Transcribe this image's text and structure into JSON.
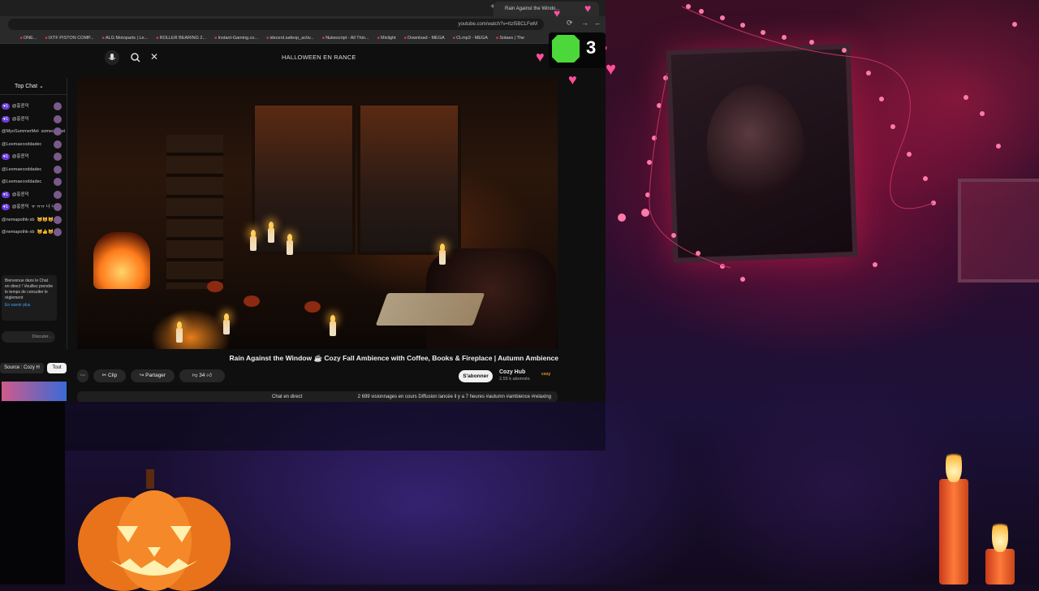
{
  "browser": {
    "tab_title": "Rain Against the Windo...",
    "address": "youtube.com/watch?v=ItzI5BCLFwM",
    "bookmarks": [
      "Solaes | The",
      "CLmp3 - MEGA",
      "Download - MEGA",
      "Mixlight",
      "Nukescript - All Thin...",
      "idecent.safeop_activ...",
      "Instant-Gaming.co...",
      "ROLLER BEARING 2...",
      "ALG Motoparts | Le...",
      "IXTF PISTON COMP...",
      "ONE..."
    ]
  },
  "youtube": {
    "search_query": "HALLOWEEN EN RANCE",
    "video_title": "Rain Against the Window ☕ Cozy Fall Ambience with Coffee, Books & Fireplace | Autumn Ambience",
    "channel_name": "Cozy Hub",
    "subscribers": "2,55 k abonnés",
    "channel_logo_text": "cozy",
    "subscribe_label": "S'abonner",
    "likes": "34",
    "share_label": "Partager",
    "clip_label": "Clip",
    "description": "2 699 visionnages en cours   Diffusion lancée il y a 7 heures   #autumn #ambience #relaxing",
    "live_chat_label": "Chat en direct"
  },
  "chat": {
    "header": "Top Chat",
    "messages": [
      {
        "user": "@홍콩덕",
        "text": "",
        "badge": "♥1"
      },
      {
        "user": "@홍콩덕",
        "text": "",
        "badge": "♥1"
      },
      {
        "user": "@MyoSummerMel",
        "text": "someone will give a Fake World",
        "badge": ""
      },
      {
        "user": "@Leemaecoddadec",
        "text": "",
        "badge": ""
      },
      {
        "user": "@홍콩덕",
        "text": "",
        "badge": "♥1"
      },
      {
        "user": "@Leemaecoddadec",
        "text": "",
        "badge": ""
      },
      {
        "user": "@Leemaecoddadec",
        "text": "",
        "badge": ""
      },
      {
        "user": "@홍콩덕",
        "text": "",
        "badge": "♥1"
      },
      {
        "user": "@홍콩덕",
        "text": "ㅠ ㅠㅠ 너 너 너",
        "badge": "♥1"
      },
      {
        "user": "@nemapothk-xb",
        "text": "😺😺😺",
        "badge": ""
      },
      {
        "user": "@nemapothk-xb",
        "text": "😺👍😺",
        "badge": ""
      }
    ],
    "welcome_text": "Bienvenue dans le Chat en direct ! Veuillez prendre le temps de consulter le règlement",
    "learn_more": "En savoir plus",
    "input_placeholder": "Discuter...",
    "chip_all": "Tout",
    "chip_source": "Source : Cozy H"
  },
  "overlay": {
    "counter": "3"
  },
  "colors": {
    "accent": "#ff3d6e",
    "heart": "#ff4f9a",
    "badge_green": "#4cd83a"
  }
}
